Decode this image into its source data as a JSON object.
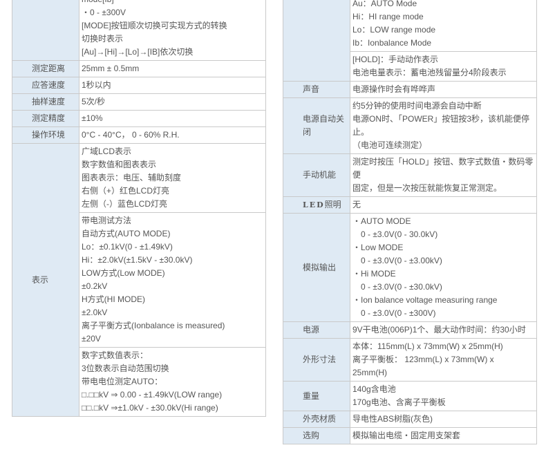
{
  "colors": {
    "label_bg": "#dfeaf4",
    "border": "#c9c9c9",
    "text": "#555555",
    "page_bg": "#ffffff"
  },
  "left_table": {
    "rows": [
      {
        "lines": [
          "mode[Ib]",
          "・0 - ±300V",
          "[MODE]按钮顺次切换可实现方式的转换",
          "切换时表示",
          "[Au]→[Hi]→[Lo]→[IB]依次切换"
        ]
      },
      {
        "label": "测定距离",
        "lines": [
          "25mm ± 0.5mm"
        ]
      },
      {
        "label": "应答速度",
        "lines": [
          "1秒以内"
        ]
      },
      {
        "label": "抽样速度",
        "lines": [
          "5次/秒"
        ]
      },
      {
        "label": "测定精度",
        "lines": [
          "±10%"
        ]
      },
      {
        "label": "操作环境",
        "lines": [
          "0°C - 40°C， 0 - 60% R.H."
        ]
      },
      {
        "label": "表示",
        "blocks": [
          [
            "广域LCD表示",
            "数字数值和图表表示",
            "图表表示：电压、辅助刻度",
            "右侧（+）红色LCD灯亮",
            "左侧（-）蓝色LCD灯亮"
          ],
          [
            "带电测试方法",
            "自动方式(AUTO MODE)",
            "Lo：±0.1kV(0 - ±1.49kV)",
            "Hi：±2.0kV(±1.5kV - ±30.0kV)",
            "LOW方式(Low MODE)",
            "±0.2kV",
            "H方式(HI MODE)",
            "±2.0kV",
            "离子平衡方式(Ionbalance is measured)",
            "±20V"
          ],
          [
            "数字式数值表示：",
            "3位数表示自动范围切换",
            "带电电位测定AUTO：",
            "□.□□kV ⇒ 0.00 - ±1.49kV(LOW range)",
            "□□.□kV ⇒±1.0kV - ±30.0kV(Hi range)"
          ]
        ]
      }
    ]
  },
  "right_table": {
    "rows": [
      {
        "blocks": [
          [
            "Au：AUTO Mode",
            "Hi：HI range mode",
            "Lo：LOW range mode",
            "Ib：Ionbalance Mode"
          ],
          [
            "[HOLD]：手动动作表示",
            "电池电量表示：蓄电池残留量分4阶段表示"
          ]
        ]
      },
      {
        "label": "声音",
        "lines": [
          "电源操作时会有哗哗声"
        ]
      },
      {
        "label": "电源自动关闭",
        "lines": [
          "约5分钟的使用时间电源会自动中断",
          "电源ON时、「POWER」按钮按3秒，该机能便停",
          "止。",
          "（电池可连续测定）"
        ]
      },
      {
        "label": "手动机能",
        "lines": [
          "测定时按压「HOLD」按钮、数字式数值・数码零",
          "便",
          "固定，但是一次按压就能恢复正常测定。"
        ]
      },
      {
        "label_bold": "LED",
        "label": "照明",
        "lines": [
          "无"
        ]
      },
      {
        "label": "模拟输出",
        "lines": [
          "・AUTO MODE",
          "0 - ±3.0V(0 - 30.0kV)",
          "・Low MODE",
          "0 - ±3.0V(0 - ±3.00kV)",
          "・Hi MODE",
          "0 - ±3.0V(0 - ±30.0kV)",
          "・Ion balance voltage measuring range",
          "0 - ±3.0V(0 - ±300V)"
        ]
      },
      {
        "label": "电源",
        "lines": [
          "9V干电池(006P)1个、最大动作时间：约30小时"
        ]
      },
      {
        "label": "外形寸法",
        "lines": [
          "本体：115mm(L) x 73mm(W) x 25mm(H)",
          "离子平衡板： 123mm(L) x 73mm(W) x",
          "25mm(H)"
        ]
      },
      {
        "label": "重量",
        "lines": [
          "140g含电池",
          "170g电池、含离子平衡板"
        ]
      },
      {
        "label": "外壳材质",
        "lines": [
          "导电性ABS树脂(灰色)"
        ]
      },
      {
        "label": "选购",
        "lines": [
          "模拟输出电缆・固定用支架套"
        ]
      }
    ]
  }
}
